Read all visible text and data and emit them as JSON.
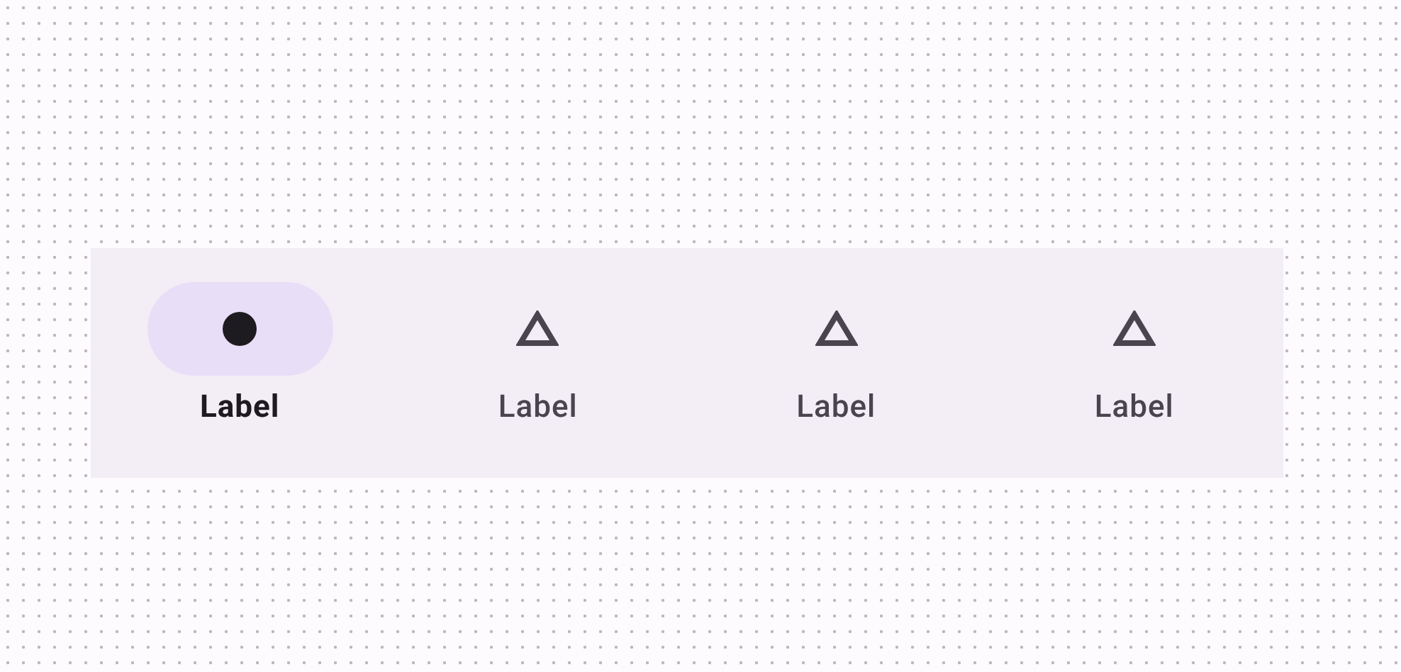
{
  "navigation_bar": {
    "items": [
      {
        "label": "Label",
        "selected": true
      },
      {
        "label": "Label",
        "selected": false
      },
      {
        "label": "Label",
        "selected": false
      },
      {
        "label": "Label",
        "selected": false
      }
    ]
  }
}
